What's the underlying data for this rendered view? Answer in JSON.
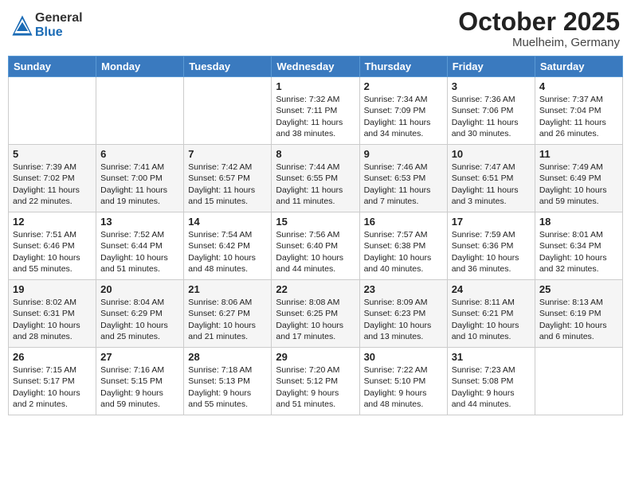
{
  "logo": {
    "general": "General",
    "blue": "Blue"
  },
  "title": {
    "month": "October 2025",
    "location": "Muelheim, Germany"
  },
  "weekdays": [
    "Sunday",
    "Monday",
    "Tuesday",
    "Wednesday",
    "Thursday",
    "Friday",
    "Saturday"
  ],
  "weeks": [
    [
      {
        "day": "",
        "content": ""
      },
      {
        "day": "",
        "content": ""
      },
      {
        "day": "",
        "content": ""
      },
      {
        "day": "1",
        "content": "Sunrise: 7:32 AM\nSunset: 7:11 PM\nDaylight: 11 hours\nand 38 minutes."
      },
      {
        "day": "2",
        "content": "Sunrise: 7:34 AM\nSunset: 7:09 PM\nDaylight: 11 hours\nand 34 minutes."
      },
      {
        "day": "3",
        "content": "Sunrise: 7:36 AM\nSunset: 7:06 PM\nDaylight: 11 hours\nand 30 minutes."
      },
      {
        "day": "4",
        "content": "Sunrise: 7:37 AM\nSunset: 7:04 PM\nDaylight: 11 hours\nand 26 minutes."
      }
    ],
    [
      {
        "day": "5",
        "content": "Sunrise: 7:39 AM\nSunset: 7:02 PM\nDaylight: 11 hours\nand 22 minutes."
      },
      {
        "day": "6",
        "content": "Sunrise: 7:41 AM\nSunset: 7:00 PM\nDaylight: 11 hours\nand 19 minutes."
      },
      {
        "day": "7",
        "content": "Sunrise: 7:42 AM\nSunset: 6:57 PM\nDaylight: 11 hours\nand 15 minutes."
      },
      {
        "day": "8",
        "content": "Sunrise: 7:44 AM\nSunset: 6:55 PM\nDaylight: 11 hours\nand 11 minutes."
      },
      {
        "day": "9",
        "content": "Sunrise: 7:46 AM\nSunset: 6:53 PM\nDaylight: 11 hours\nand 7 minutes."
      },
      {
        "day": "10",
        "content": "Sunrise: 7:47 AM\nSunset: 6:51 PM\nDaylight: 11 hours\nand 3 minutes."
      },
      {
        "day": "11",
        "content": "Sunrise: 7:49 AM\nSunset: 6:49 PM\nDaylight: 10 hours\nand 59 minutes."
      }
    ],
    [
      {
        "day": "12",
        "content": "Sunrise: 7:51 AM\nSunset: 6:46 PM\nDaylight: 10 hours\nand 55 minutes."
      },
      {
        "day": "13",
        "content": "Sunrise: 7:52 AM\nSunset: 6:44 PM\nDaylight: 10 hours\nand 51 minutes."
      },
      {
        "day": "14",
        "content": "Sunrise: 7:54 AM\nSunset: 6:42 PM\nDaylight: 10 hours\nand 48 minutes."
      },
      {
        "day": "15",
        "content": "Sunrise: 7:56 AM\nSunset: 6:40 PM\nDaylight: 10 hours\nand 44 minutes."
      },
      {
        "day": "16",
        "content": "Sunrise: 7:57 AM\nSunset: 6:38 PM\nDaylight: 10 hours\nand 40 minutes."
      },
      {
        "day": "17",
        "content": "Sunrise: 7:59 AM\nSunset: 6:36 PM\nDaylight: 10 hours\nand 36 minutes."
      },
      {
        "day": "18",
        "content": "Sunrise: 8:01 AM\nSunset: 6:34 PM\nDaylight: 10 hours\nand 32 minutes."
      }
    ],
    [
      {
        "day": "19",
        "content": "Sunrise: 8:02 AM\nSunset: 6:31 PM\nDaylight: 10 hours\nand 28 minutes."
      },
      {
        "day": "20",
        "content": "Sunrise: 8:04 AM\nSunset: 6:29 PM\nDaylight: 10 hours\nand 25 minutes."
      },
      {
        "day": "21",
        "content": "Sunrise: 8:06 AM\nSunset: 6:27 PM\nDaylight: 10 hours\nand 21 minutes."
      },
      {
        "day": "22",
        "content": "Sunrise: 8:08 AM\nSunset: 6:25 PM\nDaylight: 10 hours\nand 17 minutes."
      },
      {
        "day": "23",
        "content": "Sunrise: 8:09 AM\nSunset: 6:23 PM\nDaylight: 10 hours\nand 13 minutes."
      },
      {
        "day": "24",
        "content": "Sunrise: 8:11 AM\nSunset: 6:21 PM\nDaylight: 10 hours\nand 10 minutes."
      },
      {
        "day": "25",
        "content": "Sunrise: 8:13 AM\nSunset: 6:19 PM\nDaylight: 10 hours\nand 6 minutes."
      }
    ],
    [
      {
        "day": "26",
        "content": "Sunrise: 7:15 AM\nSunset: 5:17 PM\nDaylight: 10 hours\nand 2 minutes."
      },
      {
        "day": "27",
        "content": "Sunrise: 7:16 AM\nSunset: 5:15 PM\nDaylight: 9 hours\nand 59 minutes."
      },
      {
        "day": "28",
        "content": "Sunrise: 7:18 AM\nSunset: 5:13 PM\nDaylight: 9 hours\nand 55 minutes."
      },
      {
        "day": "29",
        "content": "Sunrise: 7:20 AM\nSunset: 5:12 PM\nDaylight: 9 hours\nand 51 minutes."
      },
      {
        "day": "30",
        "content": "Sunrise: 7:22 AM\nSunset: 5:10 PM\nDaylight: 9 hours\nand 48 minutes."
      },
      {
        "day": "31",
        "content": "Sunrise: 7:23 AM\nSunset: 5:08 PM\nDaylight: 9 hours\nand 44 minutes."
      },
      {
        "day": "",
        "content": ""
      }
    ]
  ]
}
